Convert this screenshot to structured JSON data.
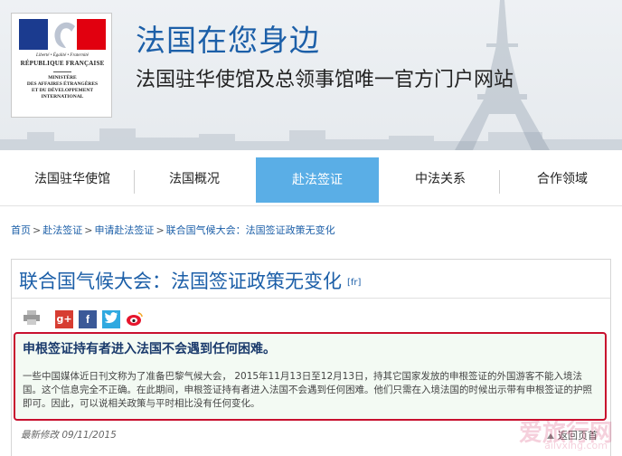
{
  "header": {
    "logo": {
      "motto": "Liberté • Égalité • Fraternité",
      "republic": "RÉPUBLIQUE FRANÇAISE",
      "ministry_line1": "MINISTÈRE",
      "ministry_line2": "DES AFFAIRES ÉTRANGÈRES",
      "ministry_line3": "ET DU DÉVELOPPEMENT",
      "ministry_line4": "INTERNATIONAL"
    },
    "title": "法国在您身边",
    "subtitle": "法国驻华使馆及总领事馆唯一官方门户网站"
  },
  "nav": {
    "items": [
      {
        "label": "法国驻华使馆"
      },
      {
        "label": "法国概况"
      },
      {
        "label": "赴法签证"
      },
      {
        "label": "中法关系"
      },
      {
        "label": "合作领域"
      }
    ],
    "active_index": 2
  },
  "breadcrumb": {
    "items": [
      "首页",
      "赴法签证",
      "申请赴法签证",
      "联合国气候大会：法国签证政策无变化"
    ],
    "separator": ">"
  },
  "article": {
    "title": "联合国气候大会：法国签证政策无变化",
    "lang_tag": "[fr]",
    "share_icons": [
      "print-icon",
      "google-plus-icon",
      "facebook-icon",
      "twitter-icon",
      "weibo-icon"
    ],
    "notice_heading": "申根签证持有者进入法国不会遇到任何困难。",
    "notice_body": "一些中国媒体近日刊文称为了准备巴黎气候大会， 2015年11月13日至12月13日，持其它国家发放的申根签证的外国游客不能入境法国。这个信息完全不正确。在此期间，申根签证持有者进入法国不会遇到任何困难。他们只需在入境法国的时候出示带有申根签证的护照即可。因此，可以说相关政策与平时相比没有任何变化。",
    "updated": "最新修改 09/11/2015",
    "back_top": "返回页首"
  },
  "watermark": {
    "text": "爱旅行网",
    "url": "ailvxing.com"
  },
  "colors": {
    "brand_blue": "#1c5fa8",
    "nav_active": "#5aaee6",
    "notice_border": "#c8102e",
    "notice_bg": "#f3faf3"
  }
}
